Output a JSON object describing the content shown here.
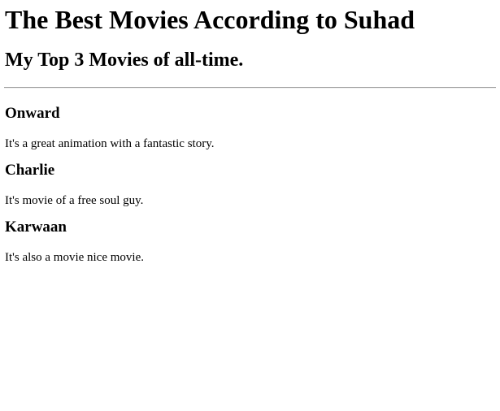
{
  "header": {
    "title": "The Best Movies According to Suhad",
    "subtitle": "My Top 3 Movies of all-time."
  },
  "movies": [
    {
      "title": "Onward",
      "description": "It's a great animation with a fantastic story."
    },
    {
      "title": "Charlie",
      "description": "It's movie of a free soul guy."
    },
    {
      "title": "Karwaan",
      "description": "It's also a movie nice movie."
    }
  ]
}
